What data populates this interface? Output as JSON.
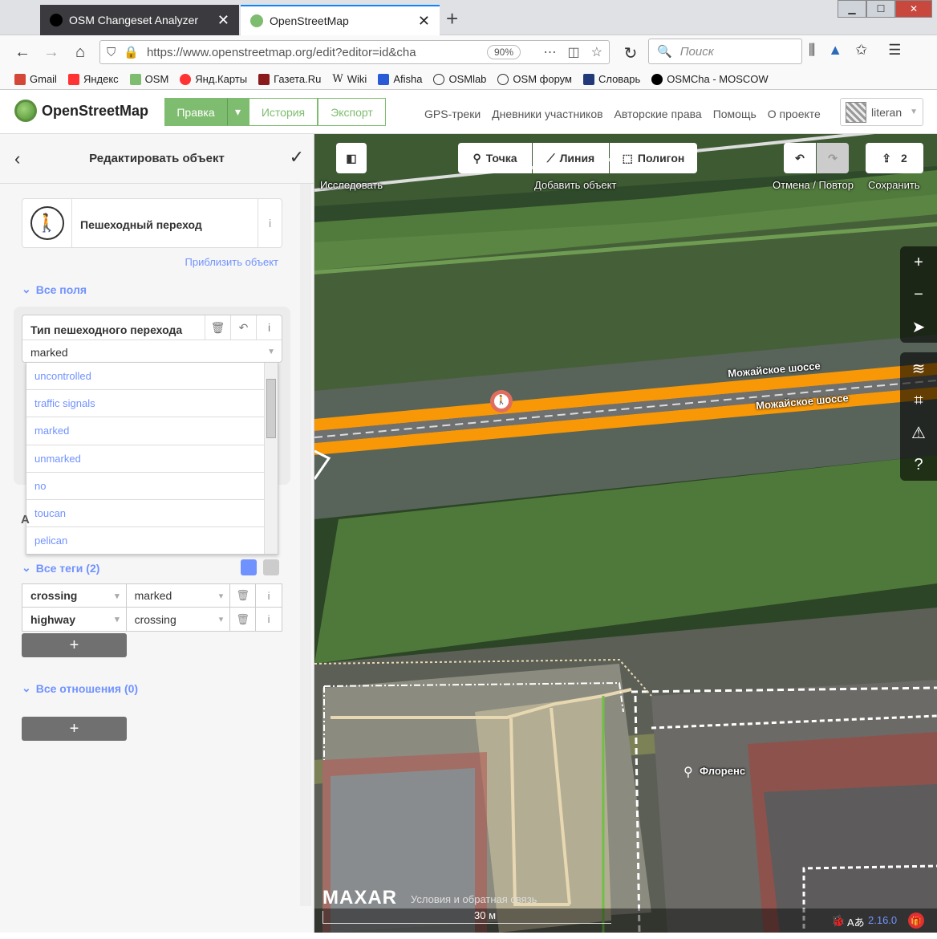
{
  "browser": {
    "tabs": [
      {
        "title": "OSM Changeset Analyzer"
      },
      {
        "title": "OpenStreetMap"
      }
    ],
    "url": "https://www.openstreetmap.org/edit?editor=id&cha",
    "zoom": "90%",
    "search_placeholder": "Поиск",
    "bookmarks": [
      "Gmail",
      "Яндекс",
      "OSM",
      "Янд.Карты",
      "Газета.Ru",
      "Wiki",
      "Afisha",
      "OSMlab",
      "OSM форум",
      "Словарь",
      "OSMCha - MOSCOW"
    ]
  },
  "osm": {
    "brand": "OpenStreetMap",
    "edit": "Правка",
    "history": "История",
    "export": "Экспорт",
    "links": [
      "GPS-треки",
      "Дневники участников",
      "Авторские права",
      "Помощь",
      "О проекте"
    ],
    "user": "literan"
  },
  "sidebar": {
    "title": "Редактировать объект",
    "preset_name": "Пешеходный переход",
    "zoom_to": "Приблизить объект",
    "all_fields": "Все поля",
    "field_label": "Тип пешеходного перехода",
    "field_value": "marked",
    "options": [
      "uncontrolled",
      "traffic signals",
      "marked",
      "unmarked",
      "no",
      "toucan",
      "pelican"
    ],
    "hidden_letter": "А",
    "all_tags": "Все теги (2)",
    "tags": [
      {
        "key": "crossing",
        "value": "marked"
      },
      {
        "key": "highway",
        "value": "crossing"
      }
    ],
    "add": "+",
    "all_relations": "Все отношения (0)"
  },
  "map": {
    "explore": "Исследовать",
    "point": "Точка",
    "line": "Линия",
    "polygon": "Полигон",
    "add_feature": "Добавить объект",
    "undo_redo": "Отмена / Повтор",
    "save": "Сохранить",
    "save_count": "2",
    "road_name": "Можайское шоссе",
    "poi_name": "Флоренс",
    "imagery": "MAXAR",
    "attribution": "Условия и обратная связь",
    "scale": "30 м",
    "version": "2.16.0"
  },
  "colors": {
    "osm_green": "#7ebc6f",
    "link_blue": "#7092ff",
    "road_orange": "#f99806"
  }
}
